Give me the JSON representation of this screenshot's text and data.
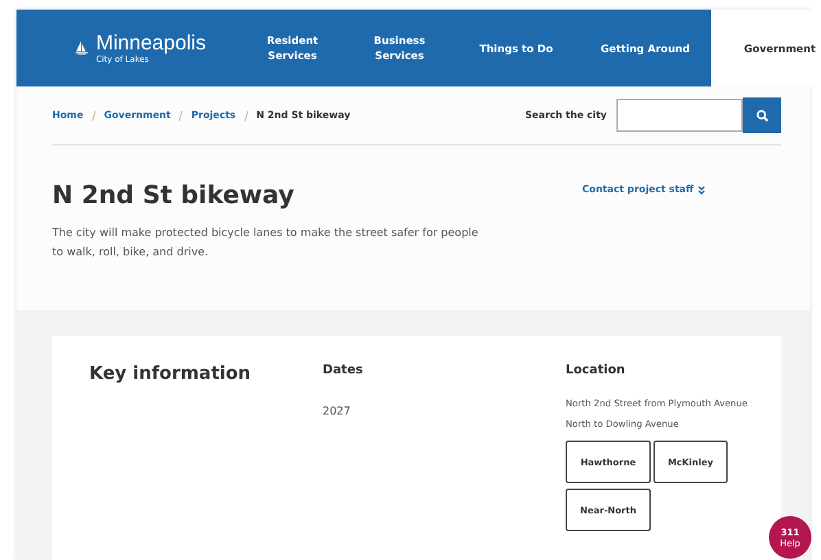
{
  "header": {
    "logo": {
      "name": "Minneapolis",
      "tagline": "City of Lakes"
    },
    "nav": [
      {
        "label": "Resident Services",
        "selected": false
      },
      {
        "label": "Business Services",
        "selected": false
      },
      {
        "label": "Things to Do",
        "selected": false
      },
      {
        "label": "Getting Around",
        "selected": false
      },
      {
        "label": "Government",
        "selected": true
      }
    ]
  },
  "breadcrumbs": [
    "Home",
    "Government",
    "Projects",
    "N 2nd St bikeway"
  ],
  "search": {
    "label": "Search the city"
  },
  "title": "N 2nd St bikeway",
  "summary": "The city will make protected bicycle lanes to make the street safer for people to walk, roll, bike, and drive.",
  "contact_link": "Contact project staff",
  "key_info": {
    "heading": "Key information",
    "dates": {
      "heading": "Dates",
      "value": "2027"
    },
    "location": {
      "heading": "Location",
      "value": "North 2nd Street from Plymouth Avenue North to Dowling Avenue",
      "tags": [
        "Hawthorne",
        "McKinley",
        "Near-North"
      ]
    }
  },
  "help_button": {
    "number": "311",
    "label": "Help"
  }
}
